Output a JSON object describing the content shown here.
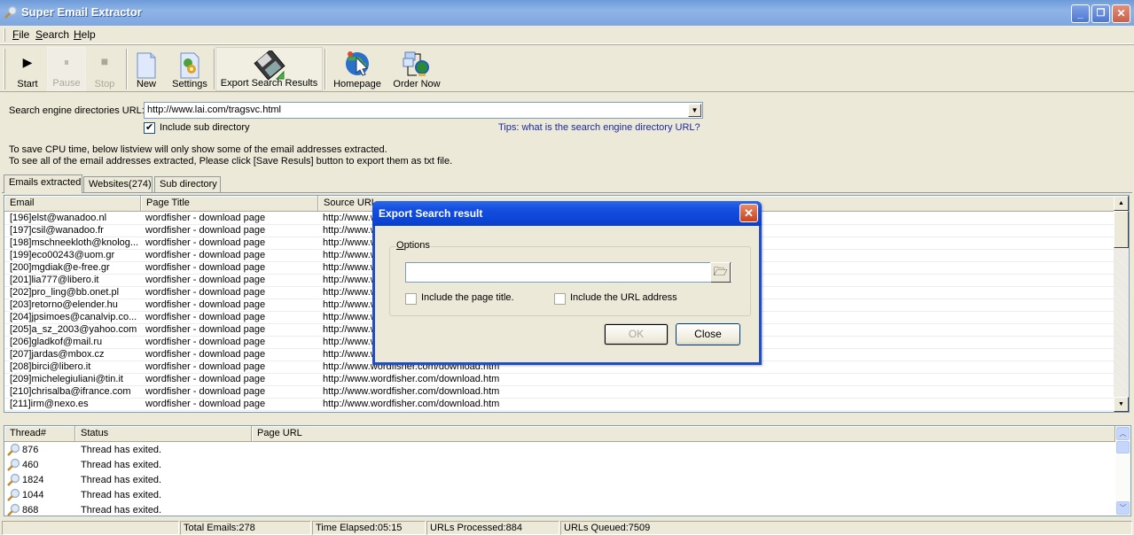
{
  "window": {
    "title": "Super Email Extractor",
    "controls": {
      "minimize": "_",
      "restore": "❐",
      "close": "✕"
    }
  },
  "menu": [
    {
      "label": "File",
      "accel": "F",
      "rest": "ile"
    },
    {
      "label": "Search",
      "accel": "S",
      "rest": "earch"
    },
    {
      "label": "Help",
      "accel": "H",
      "rest": "elp"
    }
  ],
  "toolbar": {
    "buttons": [
      {
        "label": "Start",
        "icon": "play-icon",
        "glyph": "▶",
        "enabled": true
      },
      {
        "label": "Pause",
        "icon": "pause-icon",
        "glyph": "⏸",
        "enabled": false
      },
      {
        "label": "Stop",
        "icon": "stop-icon",
        "glyph": "■",
        "enabled": false
      },
      {
        "label": "New",
        "icon": "new-document-icon",
        "enabled": true
      },
      {
        "label": "Settings",
        "icon": "settings-icon",
        "enabled": true
      },
      {
        "label": "Export Search Results",
        "icon": "floppy-disk-icon",
        "enabled": true,
        "pressed": true
      },
      {
        "label": "Homepage",
        "icon": "globe-cursor-icon",
        "enabled": true
      },
      {
        "label": "Order Now",
        "icon": "network-globe-icon",
        "enabled": true
      }
    ]
  },
  "search": {
    "label": "Search engine directories  URL:",
    "url_value": "http://www.lai.com/tragsvc.html",
    "include_sub_directory_label": "Include sub directory",
    "include_sub_directory_checked": true,
    "tips_link": "Tips: what is the search engine directory URL?"
  },
  "info_lines": [
    "To save CPU time, below listview will only show some of the email addresses extracted.",
    "To see all of the email addresses extracted, Please click [Save Resuls] button to export them as txt file."
  ],
  "tabs": [
    {
      "label": "Emails extracted",
      "active": true
    },
    {
      "label": "Websites(274)",
      "active": false
    },
    {
      "label": "Sub directory",
      "active": false
    }
  ],
  "emails_table": {
    "columns": [
      "Email",
      "Page Title",
      "Source URL"
    ],
    "rows": [
      [
        "[196]elst@wanadoo.nl",
        "wordfisher - download page",
        "http://www.wordfisher.com/download.htm"
      ],
      [
        "[197]csil@wanadoo.fr",
        "wordfisher - download page",
        "http://www.wordfisher.com/download.htm"
      ],
      [
        "[198]mschneekloth@knolog...",
        "wordfisher - download page",
        "http://www.wordfisher.com/download.htm"
      ],
      [
        "[199]eco00243@uom.gr",
        "wordfisher - download page",
        "http://www.wordfisher.com/download.htm"
      ],
      [
        "[200]mgdiak@e-free.gr",
        "wordfisher - download page",
        "http://www.wordfisher.com/download.htm"
      ],
      [
        "[201]lia777@libero.it",
        "wordfisher - download page",
        "http://www.wordfisher.com/download.htm"
      ],
      [
        "[202]pro_ling@bb.onet.pl",
        "wordfisher - download page",
        "http://www.wordfisher.com/download.htm"
      ],
      [
        "[203]retorno@elender.hu",
        "wordfisher - download page",
        "http://www.wordfisher.com/download.htm"
      ],
      [
        "[204]jpsimoes@canalvip.co...",
        "wordfisher - download page",
        "http://www.wordfisher.com/download.htm"
      ],
      [
        "[205]a_sz_2003@yahoo.com",
        "wordfisher - download page",
        "http://www.wordfisher.com/download.htm"
      ],
      [
        "[206]gladkof@mail.ru",
        "wordfisher - download page",
        "http://www.wordfisher.com/download.htm"
      ],
      [
        "[207]jardas@mbox.cz",
        "wordfisher - download page",
        "http://www.wordfisher.com/download.htm"
      ],
      [
        "[208]birci@libero.it",
        "wordfisher - download page",
        "http://www.wordfisher.com/download.htm"
      ],
      [
        "[209]michelegiuliani@tin.it",
        "wordfisher - download page",
        "http://www.wordfisher.com/download.htm"
      ],
      [
        "[210]chrisalba@ifrance.com",
        "wordfisher - download page",
        "http://www.wordfisher.com/download.htm"
      ],
      [
        "[211]irm@nexo.es",
        "wordfisher - download page",
        "http://www.wordfisher.com/download.htm"
      ]
    ]
  },
  "threads_table": {
    "columns": [
      "Thread#",
      "Status",
      "Page URL"
    ],
    "rows": [
      {
        "thread": "876",
        "status": "Thread has exited.",
        "url": ""
      },
      {
        "thread": "460",
        "status": "Thread has exited.",
        "url": ""
      },
      {
        "thread": "1824",
        "status": "Thread has exited.",
        "url": ""
      },
      {
        "thread": "1044",
        "status": "Thread has exited.",
        "url": ""
      },
      {
        "thread": "868",
        "status": "Thread has exited.",
        "url": ""
      }
    ]
  },
  "statusbar": {
    "total_emails": "Total Emails:278",
    "time_elapsed": "Time Elapsed:05:15",
    "urls_processed": "URLs Processed:884",
    "urls_queued": "URLs Queued:7509"
  },
  "dialog": {
    "title": "Export Search result",
    "group_label": "Options",
    "group_accel": "O",
    "group_rest": "ptions",
    "file_path_value": "",
    "include_page_title_label": "Include the page title.",
    "include_page_title_checked": false,
    "include_url_label": "Include the URL address",
    "include_url_checked": false,
    "ok_label": "OK",
    "ok_enabled": false,
    "close_label": "Close",
    "close_glyph": "✕",
    "browse_glyph": "🗁"
  },
  "colors": {
    "title_bar_inactive": "#7ea6e0",
    "dialog_title_active": "#0d46d8",
    "tips_link": "#1a2aa0",
    "window_bg": "#ece9d8"
  }
}
